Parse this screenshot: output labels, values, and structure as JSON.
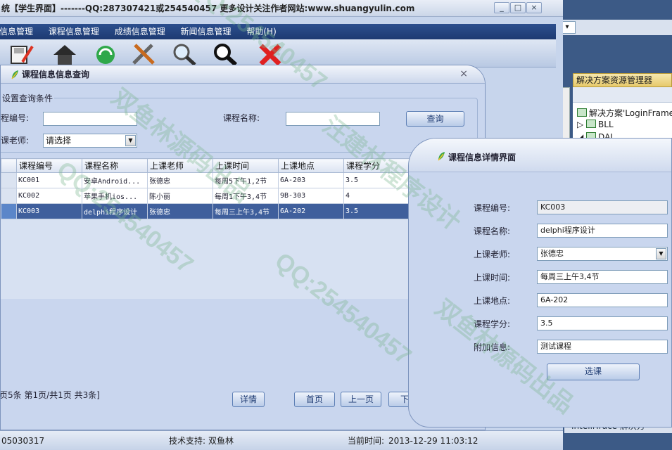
{
  "main_window": {
    "title": "统【学生界面】-------QQ:287307421或254540457  更多设计关注作者网站:www.shuangyulin.com",
    "buttons": {
      "minimize": "_",
      "maximize": "□",
      "close": "×"
    }
  },
  "menu": [
    "信息管理",
    "课程信息管理",
    "成绩信息管理",
    "新闻信息管理",
    "帮助(H)"
  ],
  "toolbar": [
    "edit-icon",
    "home-icon",
    "recycle-icon",
    "tools-icon",
    "zoom-icon",
    "search-icon",
    "delete-icon"
  ],
  "statusbar": {
    "left": "05030317",
    "support_label": "技术支持:",
    "support_value": "双鱼林",
    "time_label": "当前时间:",
    "time_value": "2013-12-29 11:03:12"
  },
  "query_window": {
    "title": "课程信息信息查询",
    "close": "×",
    "group_legend": "设置查询条件",
    "fields": {
      "course_no_label": "程编号:",
      "course_no_value": "",
      "course_name_label": "课程名称:",
      "course_name_value": "",
      "teacher_label": "课老师:",
      "teacher_value": "请选择"
    },
    "query_button": "查询",
    "grid": {
      "columns": [
        "课程编号",
        "课程名称",
        "上课老师",
        "上课时间",
        "上课地点",
        "课程学分"
      ],
      "rows": [
        [
          "KC001",
          "安卓Android...",
          "张德忠",
          "每周5下午1,2节",
          "6A-203",
          "3.5"
        ],
        [
          "KC002",
          "苹果手机ios...",
          "陈小丽",
          "每周1下午3,4节",
          "9B-303",
          "4"
        ],
        [
          "KC003",
          "delphi程序设计",
          "张德忠",
          "每周三上午3,4节",
          "6A-202",
          "3.5"
        ]
      ],
      "selected_row": 2
    },
    "pager": {
      "summary": "页5条 第1页/共1页   共3条]",
      "detail": "详情",
      "first": "首页",
      "prev": "上一页",
      "next": "下一"
    }
  },
  "detail_window": {
    "title": "课程信息详情界面",
    "fields": [
      {
        "label": "课程编号:",
        "value": "KC003",
        "kind": "readonly"
      },
      {
        "label": "课程名称:",
        "value": "delphi程序设计",
        "kind": "text"
      },
      {
        "label": "上课老师:",
        "value": "张德忠",
        "kind": "select"
      },
      {
        "label": "上课时间:",
        "value": "每周三上午3,4节",
        "kind": "text"
      },
      {
        "label": "上课地点:",
        "value": "6A-202",
        "kind": "text"
      },
      {
        "label": "课程学分:",
        "value": "3.5",
        "kind": "text"
      },
      {
        "label": "附加信息:",
        "value": "测试课程",
        "kind": "text"
      }
    ],
    "select_button": "选课"
  },
  "vs_panel": {
    "combo_arrow": "▾",
    "solution_explorer_title": "解决方案资源管理器",
    "tree": [
      "解决方案'LoginFrame",
      "BLL",
      "DAL"
    ],
    "bottom_tab": "IntelliTrace  解决方"
  },
  "watermark": {
    "qq": "QQ:254540457",
    "text_a": "汪建林程序设计",
    "text_b": "双鱼林源码出品"
  }
}
